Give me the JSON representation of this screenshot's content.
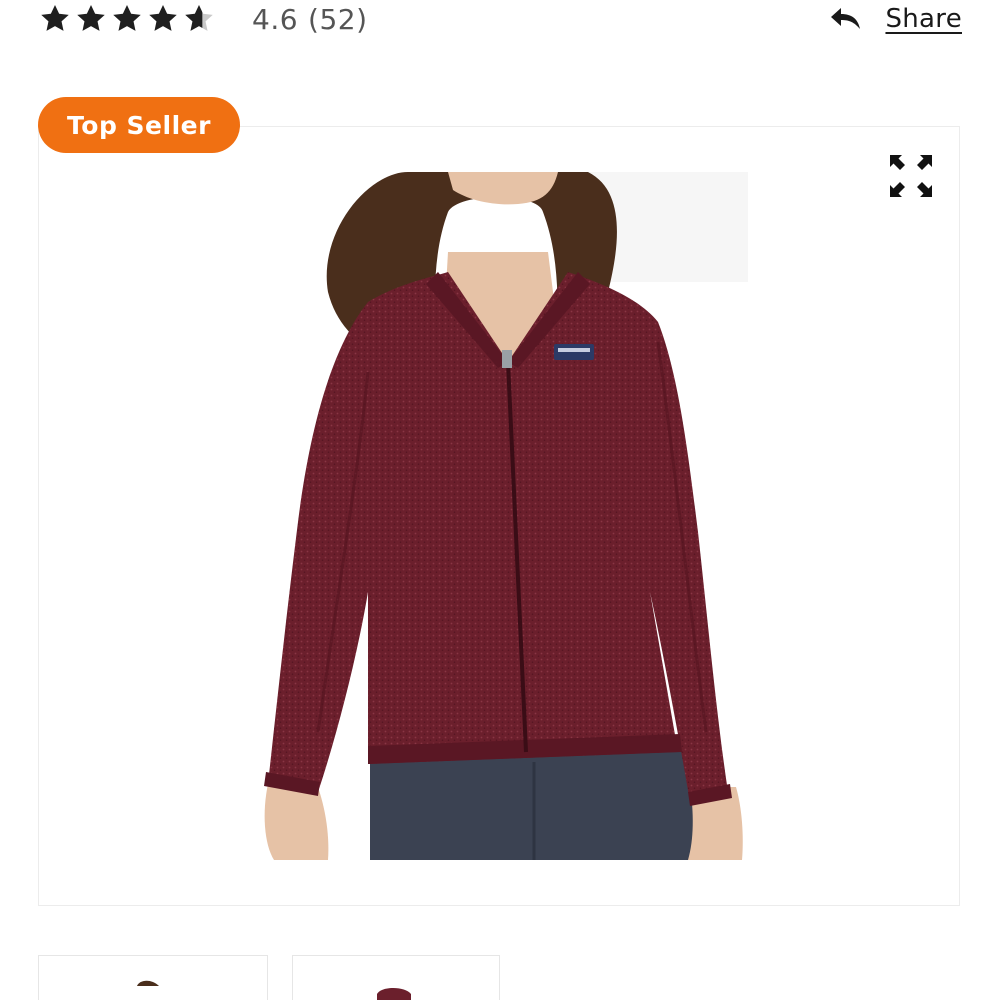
{
  "rating": {
    "value": "4.6",
    "count": "(52)",
    "stars": 4.6,
    "star_color": "#1f1f1f",
    "star_empty_color": "#c9c9c9"
  },
  "share": {
    "label": "Share",
    "icon": "reply-arrow-icon"
  },
  "badge": {
    "label": "Top Seller",
    "color": "#f07012"
  },
  "gallery": {
    "expand_icon": "expand-arrows-icon",
    "main_image": "product-photo-burgundy-fleece-jacket",
    "thumbnails": [
      "thumbnail-1",
      "thumbnail-2"
    ]
  },
  "colors": {
    "jacket": "#6b1f2c",
    "jeans": "#3b4252",
    "skin": "#e6c2a6",
    "hair": "#4a2e1c"
  }
}
